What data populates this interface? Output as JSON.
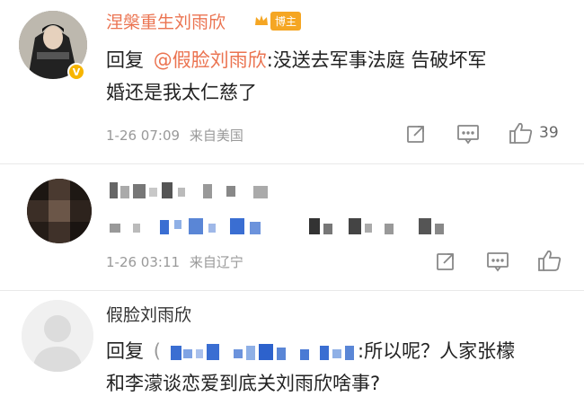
{
  "comments": [
    {
      "author": "涅槃重生刘雨欣",
      "badge": "博主",
      "reply_prefix": "回复",
      "mention": "@假脸刘雨欣",
      "text_line1": ":没送去军事法庭 告破坏军",
      "text_line2": "婚还是我太仁慈了",
      "timestamp": "1-26 07:09",
      "location": "来自美国",
      "likes": "39"
    },
    {
      "timestamp": "1-26 03:11",
      "location": "来自辽宁"
    },
    {
      "author": "假脸刘雨欣",
      "reply_prefix": "回复",
      "mention_open": "(",
      "text_line1": ":所以呢？人家张檬",
      "text_line2": "和李濛谈恋爱到底关刘雨欣啥事?"
    }
  ],
  "colors": {
    "author_orange": "#eb7350",
    "badge_bg": "#f5a623",
    "verified_badge": "#f7b500",
    "meta_gray": "#999999"
  },
  "icons": [
    "share-icon",
    "comment-icon",
    "like-icon"
  ]
}
